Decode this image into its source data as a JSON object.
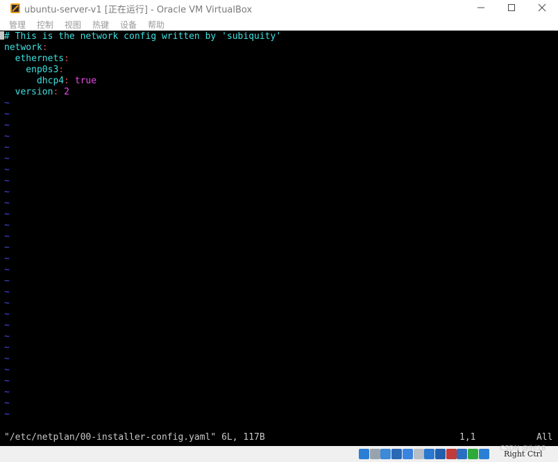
{
  "window": {
    "title": "ubuntu-server-v1 [正在运行] - Oracle VM VirtualBox",
    "min_glyph": "—",
    "max_glyph": "☐",
    "close_glyph": "✕"
  },
  "menu": [
    "管理",
    "控制",
    "视图",
    "热键",
    "设备",
    "帮助"
  ],
  "editor": {
    "lines": [
      [
        {
          "t": "# This is the network config written by 'subiquity'",
          "c": "cyan"
        }
      ],
      [
        {
          "t": "network",
          "c": "cyan"
        },
        {
          "t": ":",
          "c": "red"
        }
      ],
      [
        {
          "t": "  ethernets",
          "c": "cyan"
        },
        {
          "t": ":",
          "c": "red"
        }
      ],
      [
        {
          "t": "    enp0s3",
          "c": "cyan"
        },
        {
          "t": ":",
          "c": "red"
        }
      ],
      [
        {
          "t": "      dhcp4",
          "c": "cyan"
        },
        {
          "t": ":",
          "c": "red"
        },
        {
          "t": " true",
          "c": "mag"
        }
      ],
      [
        {
          "t": "  version",
          "c": "cyan"
        },
        {
          "t": ":",
          "c": "red"
        },
        {
          "t": " 2",
          "c": "mag"
        }
      ]
    ],
    "tilde": "~",
    "tilde_count": 29,
    "status_file": "\"/etc/netplan/00-installer-config.yaml\" 6L, 117B",
    "status_pos": "1,1",
    "status_pct": "All"
  },
  "statusbar": {
    "host_key": "Right Ctrl",
    "watermark": "CSDN @lhl18",
    "icons": [
      "disk-icon",
      "optical-drive-icon",
      "usb-icon",
      "network-icon",
      "pencil-icon",
      "shared-folder-icon",
      "display-icon",
      "monitor-icon",
      "recording-icon",
      "cpu-icon",
      "mouse-integration-icon",
      "download-icon"
    ]
  },
  "colors": {
    "cyan": "#3ee0e0",
    "red": "#e04848",
    "magenta": "#e64ce6",
    "tilde_blue": "#4848ee",
    "terminal_bg": "#000000"
  }
}
